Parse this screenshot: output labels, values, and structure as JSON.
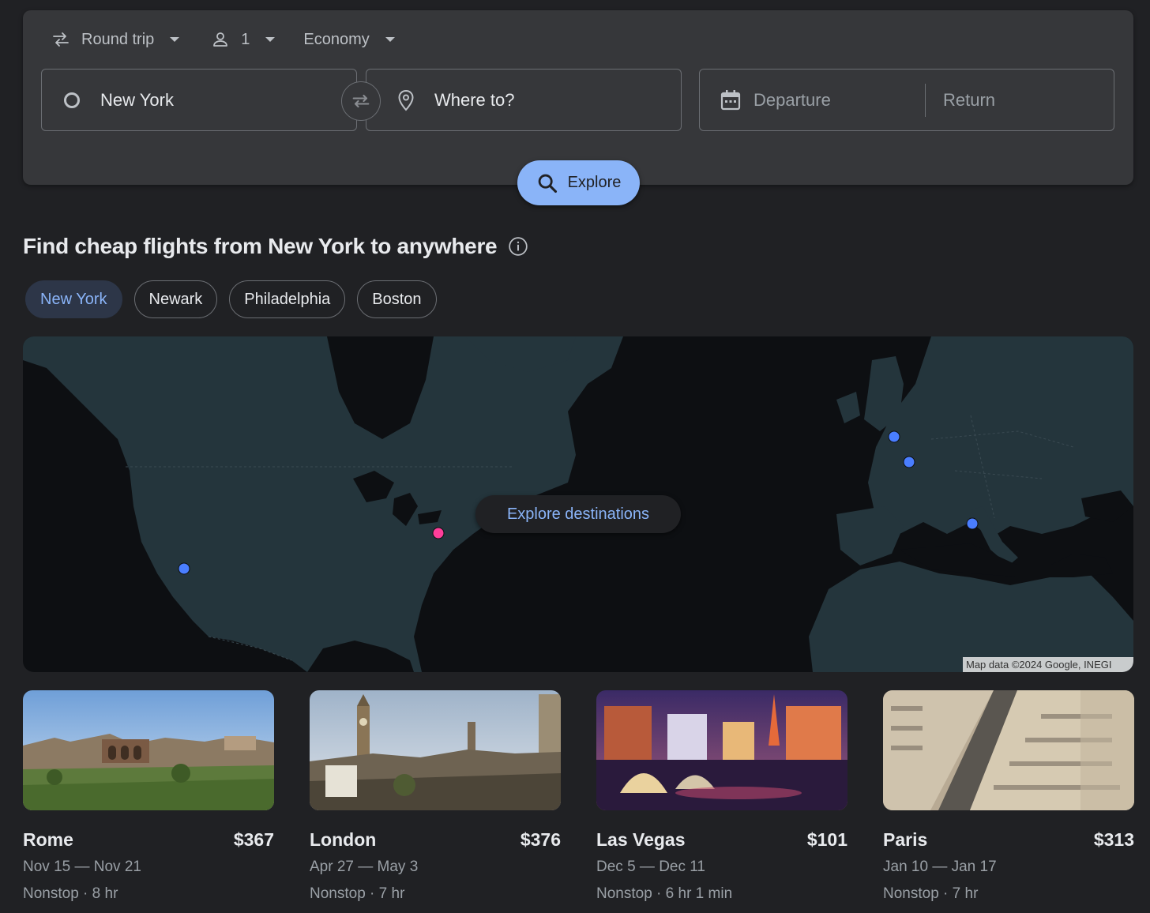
{
  "search": {
    "trip_type": "Round trip",
    "passengers": "1",
    "cabin_class": "Economy",
    "origin_value": "New York",
    "destination_placeholder": "Where to?",
    "departure_placeholder": "Departure",
    "return_placeholder": "Return",
    "explore_label": "Explore"
  },
  "heading": "Find cheap flights from New York to anywhere",
  "chips": [
    {
      "label": "New York",
      "active": true
    },
    {
      "label": "Newark",
      "active": false
    },
    {
      "label": "Philadelphia",
      "active": false
    },
    {
      "label": "Boston",
      "active": false
    }
  ],
  "map": {
    "explore_destinations_label": "Explore destinations",
    "attribution": "Map data ©2024 Google, INEGI",
    "origin_marker_color": "#ff3e9a",
    "destination_marker_color": "#4a7eff"
  },
  "destinations": [
    {
      "city": "Rome",
      "price": "$367",
      "dates": "Nov 15 — Nov 21",
      "info": "Nonstop · 8 hr"
    },
    {
      "city": "London",
      "price": "$376",
      "dates": "Apr 27 — May 3",
      "info": "Nonstop · 7 hr"
    },
    {
      "city": "Las Vegas",
      "price": "$101",
      "dates": "Dec 5 — Dec 11",
      "info": "Nonstop · 6 hr 1 min"
    },
    {
      "city": "Paris",
      "price": "$313",
      "dates": "Jan 10 — Jan 17",
      "info": "Nonstop · 7 hr"
    }
  ],
  "colors": {
    "accent": "#8ab4f8",
    "background": "#202124",
    "panel": "#36373a"
  }
}
